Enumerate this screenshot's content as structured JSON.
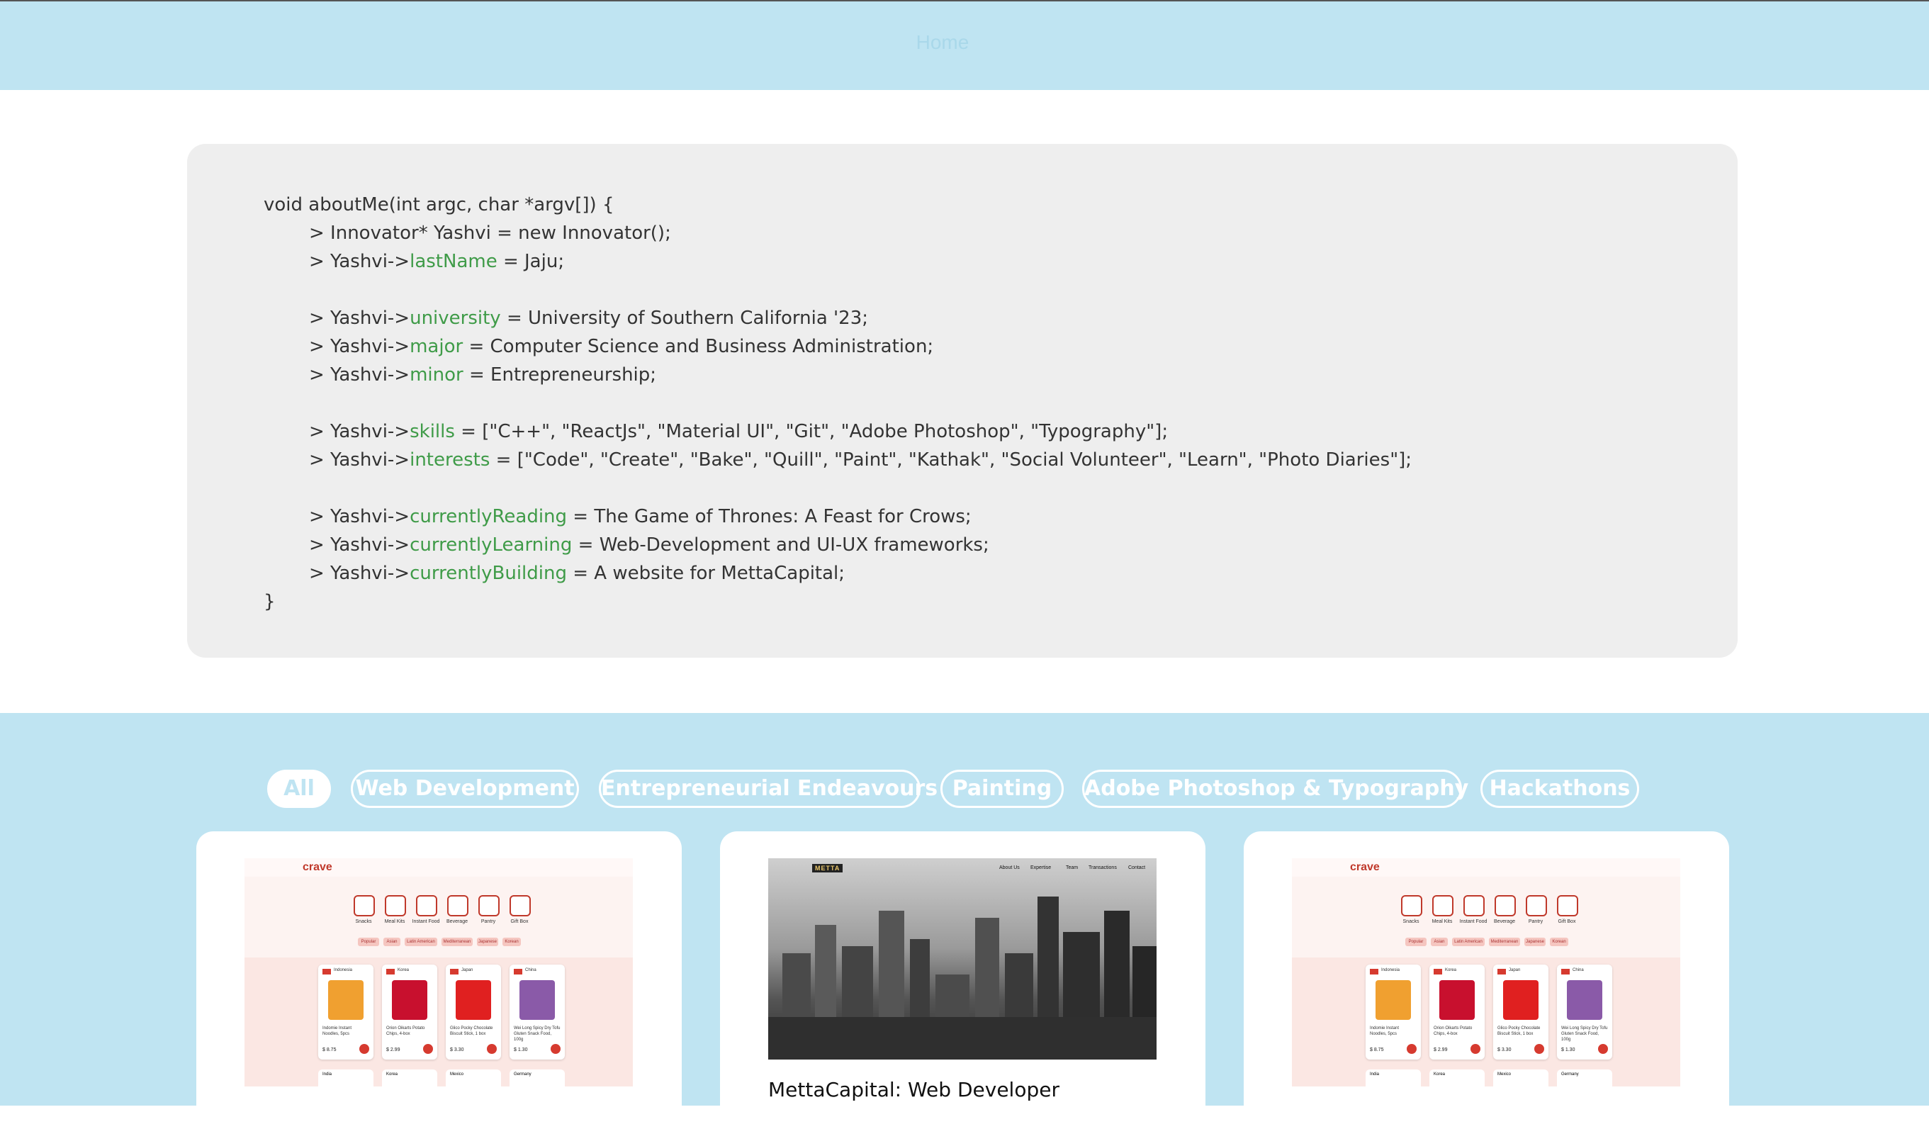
{
  "nav": {
    "home": "Home"
  },
  "code": {
    "signature": "void aboutMe(int argc, char *argv[]) {",
    "closing": "}",
    "prefix": "> Yashvi->",
    "innovator_line": "> Innovator* Yashvi = new Innovator();",
    "lines": [
      {
        "prop": "lastName",
        "rest": " = Jaju;"
      },
      {
        "prop": "university",
        "rest": " = University of Southern California '23;"
      },
      {
        "prop": "major",
        "rest": " = Computer Science and Business Administration;"
      },
      {
        "prop": "minor",
        "rest": " = Entrepreneurship;"
      },
      {
        "prop": "skills",
        "rest": " = [\"C++\", \"ReactJs\", \"Material UI\", \"Git\", \"Adobe Photoshop\", \"Typography\"];"
      },
      {
        "prop": "interests",
        "rest": " = [\"Code\", \"Create\", \"Bake\", \"Quill\", \"Paint\", \"Kathak\", \"Social Volunteer\", \"Learn\", \"Photo Diaries\"];"
      },
      {
        "prop": "currentlyReading",
        "rest": " = The Game of Thrones: A Feast for Crows;"
      },
      {
        "prop": "currentlyLearning",
        "rest": " = Web-Development and UI-UX frameworks;"
      },
      {
        "prop": "currentlyBuilding",
        "rest": " = A website for MettaCapital;"
      }
    ]
  },
  "filters": [
    {
      "label": "All",
      "active": true
    },
    {
      "label": "Web Development",
      "active": false
    },
    {
      "label": "Entrepreneurial Endeavours",
      "active": false
    },
    {
      "label": "Painting",
      "active": false
    },
    {
      "label": "Adobe Photoshop & Typography",
      "active": false
    },
    {
      "label": "Hackathons",
      "active": false
    }
  ],
  "cards": [
    {
      "type": "crave",
      "logo": "crave",
      "categories": [
        "Snacks",
        "Meal Kits",
        "Instant Food",
        "Beverage",
        "Pantry",
        "Gift Box"
      ],
      "tags": [
        "Popular",
        "Asian",
        "Latin American",
        "Mediterranean",
        "Japanese",
        "Korean"
      ],
      "products": [
        {
          "country": "Indonesia",
          "name": "Indomie Instant Noodles, 5pcs",
          "price": "$ 8.75"
        },
        {
          "country": "Korea",
          "name": "Orion Oikarts Potato Chips, 4-box",
          "price": "$ 2.99"
        },
        {
          "country": "Japan",
          "name": "Glico Pocky Chocolate Biscuit Stick, 1 box",
          "price": "$ 3.30"
        },
        {
          "country": "China",
          "name": "Wei Long Spicy Dry Tofu Gluten Snack Food, 100g",
          "price": "$ 1.30"
        }
      ],
      "products_row2": [
        "India",
        "Korea",
        "Mexico",
        "Germany"
      ]
    },
    {
      "type": "metta",
      "logo": "METTA",
      "nav": [
        "About Us",
        "Expertise",
        "Team",
        "Transactions",
        "Contact"
      ],
      "title": "MettaCapital: Web Developer"
    },
    {
      "type": "crave",
      "logo": "crave",
      "categories": [
        "Snacks",
        "Meal Kits",
        "Instant Food",
        "Beverage",
        "Pantry",
        "Gift Box"
      ],
      "tags": [
        "Popular",
        "Asian",
        "Latin American",
        "Mediterranean",
        "Japanese",
        "Korean"
      ],
      "products": [
        {
          "country": "Indonesia",
          "name": "Indomie Instant Noodles, 5pcs",
          "price": "$ 8.75"
        },
        {
          "country": "Korea",
          "name": "Orion Oikarts Potato Chips, 4-box",
          "price": "$ 2.99"
        },
        {
          "country": "Japan",
          "name": "Glico Pocky Chocolate Biscuit Stick, 1 box",
          "price": "$ 3.30"
        },
        {
          "country": "China",
          "name": "Wei Long Spicy Dry Tofu Gluten Snack Food, 100g",
          "price": "$ 1.30"
        }
      ],
      "products_row2": [
        "India",
        "Korea",
        "Mexico",
        "Germany"
      ]
    }
  ],
  "colors": {
    "accent": "#bfe4f2",
    "code_prop": "#3f9b48",
    "code_bg": "#eeeeee",
    "crave_red": "#d63a2f"
  }
}
